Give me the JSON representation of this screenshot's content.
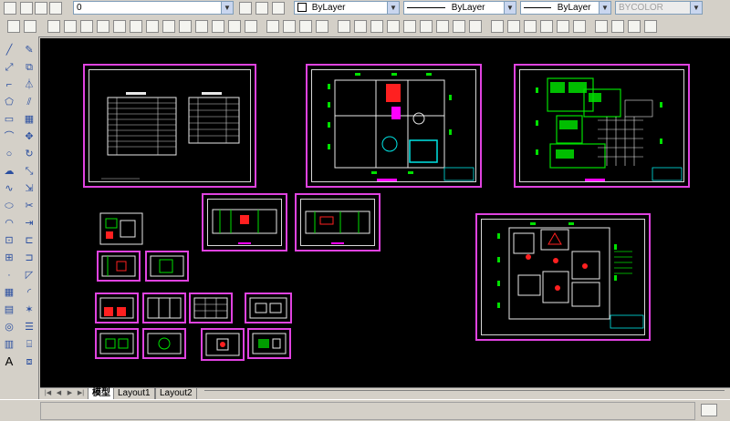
{
  "toolbar": {
    "layer_value": "0",
    "color_value": "ByLayer",
    "linetype_value": "ByLayer",
    "lineweight_value": "ByLayer",
    "plotstyle_value": "BYCOLOR"
  },
  "layout_tabs": [
    "模型",
    "Layout1",
    "Layout2"
  ],
  "active_tab": "模型",
  "colors": {
    "canvas_bg": "#000000",
    "sheet_border": "#e043e0",
    "drawing_line": "#e8e8e8",
    "accent_green": "#00e000",
    "accent_red": "#ff2020",
    "accent_cyan": "#00e5e5"
  }
}
